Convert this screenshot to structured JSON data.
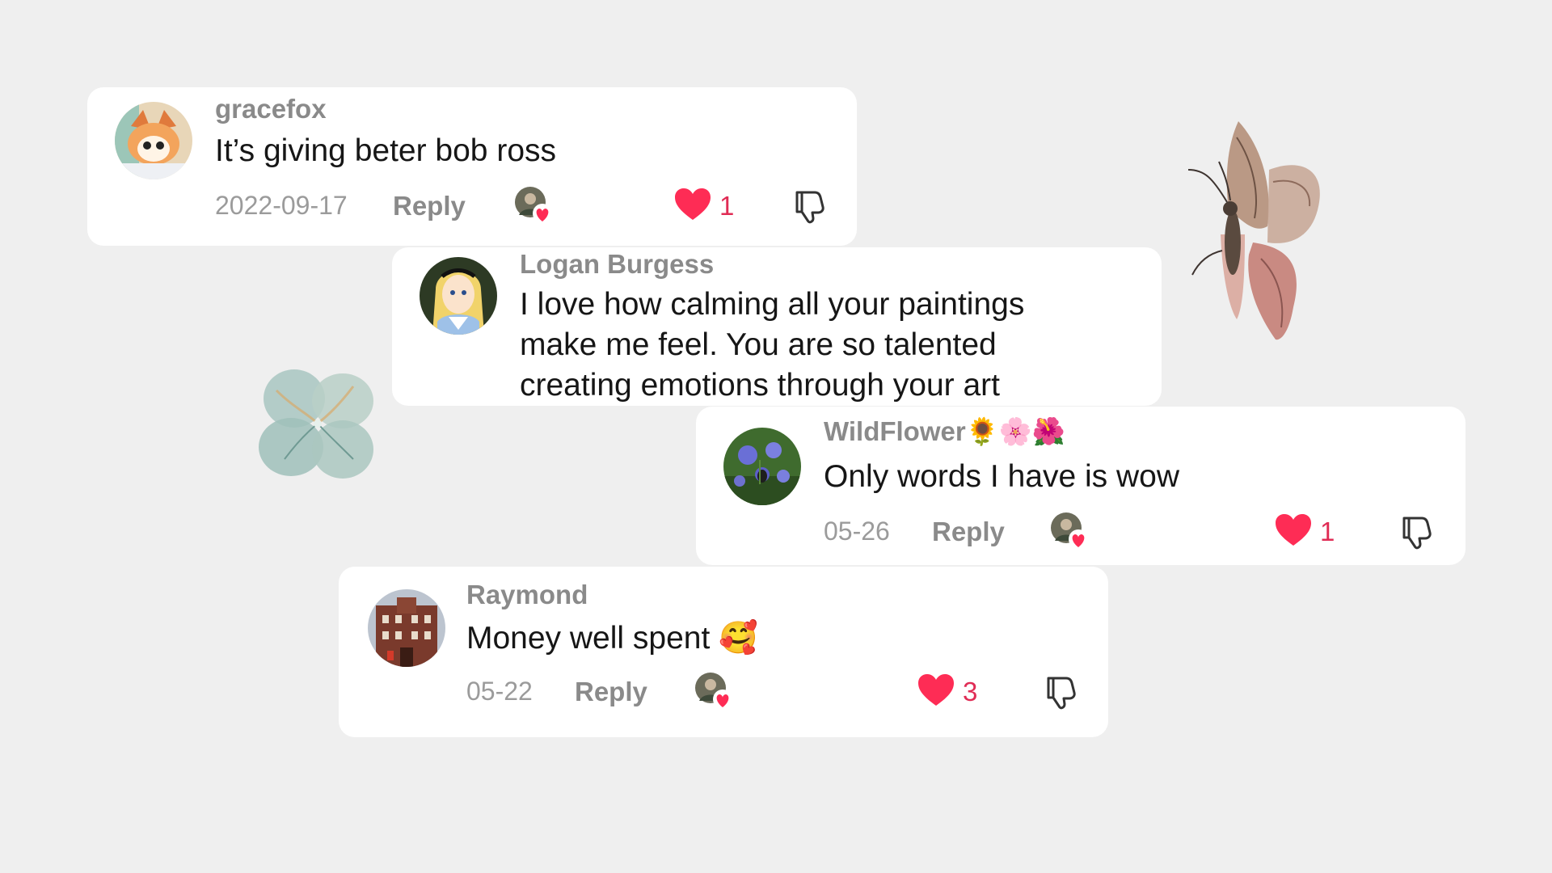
{
  "comments": [
    {
      "username": "gracefox",
      "text": "It’s giving beter bob ross",
      "date": "2022-09-17",
      "reply_label": "Reply",
      "likes": "1",
      "liked": true
    },
    {
      "username": "Logan Burgess",
      "text": "I love how calming all your paintings\nmake me feel. You are so talented\ncreating emotions through your art"
    },
    {
      "username": "WildFlower🌻🌸🌺",
      "text": "Only words I have is wow",
      "date": "05-26",
      "reply_label": "Reply",
      "likes": "1",
      "liked": true
    },
    {
      "username": "Raymond",
      "text": "Money well spent 🥰",
      "date": "05-22",
      "reply_label": "Reply",
      "likes": "3",
      "liked": true
    }
  ],
  "colors": {
    "background": "#efefef",
    "card": "#ffffff",
    "heart": "#fe2c55",
    "username": "#8a8a8a"
  },
  "icons": {
    "like": "heart-icon",
    "dislike": "thumbs-down-icon",
    "liker": "creator-liked-avatar-icon"
  }
}
